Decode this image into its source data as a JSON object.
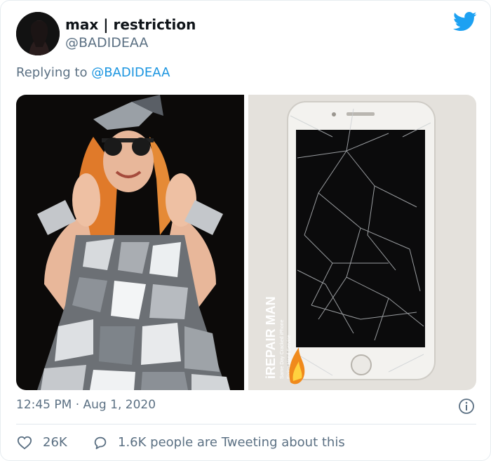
{
  "tweet": {
    "author": {
      "display_name": "max | restriction",
      "handle": "@BADIDEAA"
    },
    "reply_prefix": "Replying to ",
    "reply_to": "@BADIDEAA",
    "timestamp": "12:45 PM · Aug 1, 2020",
    "likes": "26K",
    "conversation_text": "1.6K people are Tweeting about this",
    "media": [
      {
        "name": "photo-left",
        "description_icon": "photo"
      },
      {
        "name": "photo-right",
        "description_icon": "photo"
      }
    ]
  },
  "photo_right_watermark": {
    "brand": "iREPAIR MAN",
    "tagline": "Same Day Cracked iPhone",
    "tagline2": "Fixing Hand Service"
  },
  "colors": {
    "accent": "#1da1f2",
    "muted": "#5b7083",
    "mention": "#1b95e0"
  }
}
